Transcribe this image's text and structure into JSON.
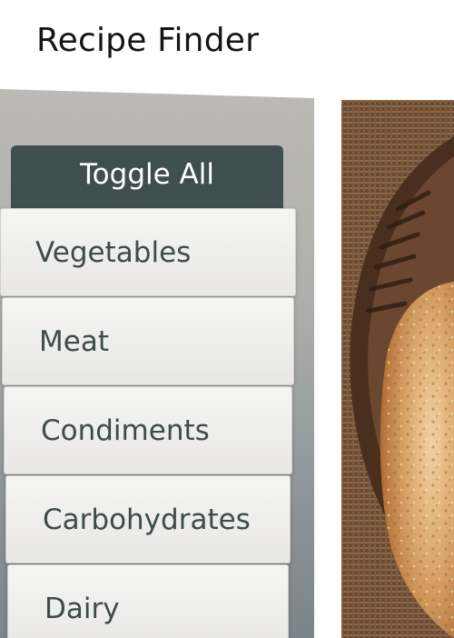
{
  "header": {
    "title": "Recipe Finder"
  },
  "sidebar": {
    "toggle_label": "Toggle All",
    "categories": [
      {
        "label": "Vegetables"
      },
      {
        "label": "Meat"
      },
      {
        "label": "Condiments"
      },
      {
        "label": "Carbohydrates"
      },
      {
        "label": "Dairy"
      }
    ]
  },
  "theme": {
    "toggle_bg": "#3f4f4f",
    "item_text": "#3f4b4b",
    "panel_top": "#bcbab6",
    "panel_bottom": "#7b848a"
  },
  "image": {
    "subject": "bread-loaf-on-burlap"
  }
}
